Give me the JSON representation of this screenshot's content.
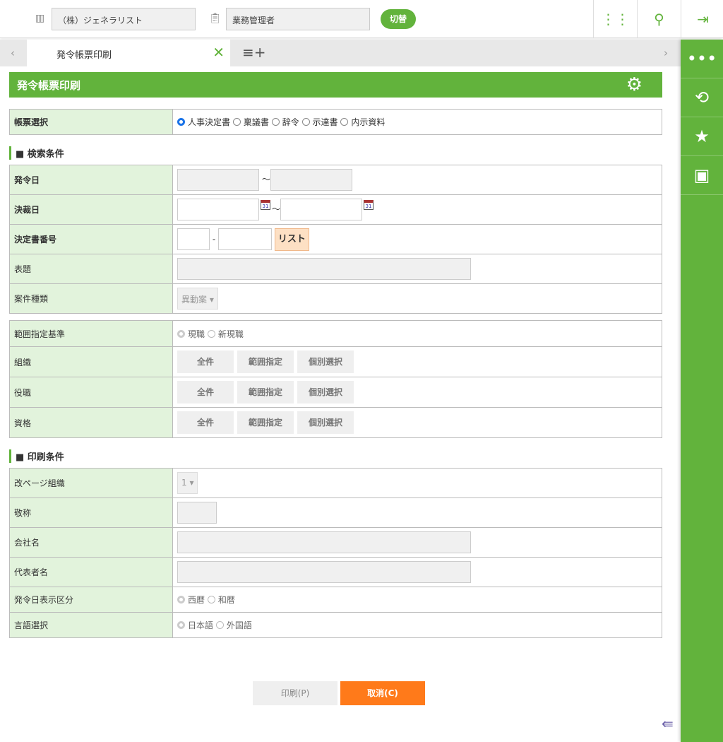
{
  "header": {
    "company": "（株）ジェネラリスト",
    "role": "業務管理者",
    "switch_label": "切替"
  },
  "tabs": [
    {
      "label": "発令帳票印刷"
    }
  ],
  "page": {
    "title": "発令帳票印刷"
  },
  "form_select": {
    "label": "帳票選択",
    "options": [
      "人事決定書",
      "稟議書",
      "辞令",
      "示達書",
      "内示資料"
    ],
    "selected": "人事決定書"
  },
  "search": {
    "heading": "■ 検索条件",
    "hatsurei_date": "発令日",
    "kessai_date": "決裁日",
    "doc_number": "決定書番号",
    "list_button": "リスト",
    "title_label": "表題",
    "case_type": "案件種類",
    "case_type_value": "異動案",
    "tilde": "～",
    "dash": "-"
  },
  "range": {
    "basis_label": "範囲指定基準",
    "basis_options": [
      "現職",
      "新現職"
    ],
    "org": "組織",
    "position": "役職",
    "qualification": "資格",
    "btn_all": "全件",
    "btn_range": "範囲指定",
    "btn_individual": "個別選択"
  },
  "print": {
    "heading": "■ 印刷条件",
    "page_break": "改ページ組織",
    "page_break_value": "1",
    "honorific": "敬称",
    "company_name": "会社名",
    "representative": "代表者名",
    "date_display": "発令日表示区分",
    "date_options": [
      "西暦",
      "和暦"
    ],
    "language": "言語選択",
    "language_options": [
      "日本語",
      "外国語"
    ]
  },
  "actions": {
    "print": "印刷(P)",
    "cancel": "取消(C)"
  },
  "colors": {
    "accent": "#62b33c",
    "cancel": "#ff7a1a"
  }
}
